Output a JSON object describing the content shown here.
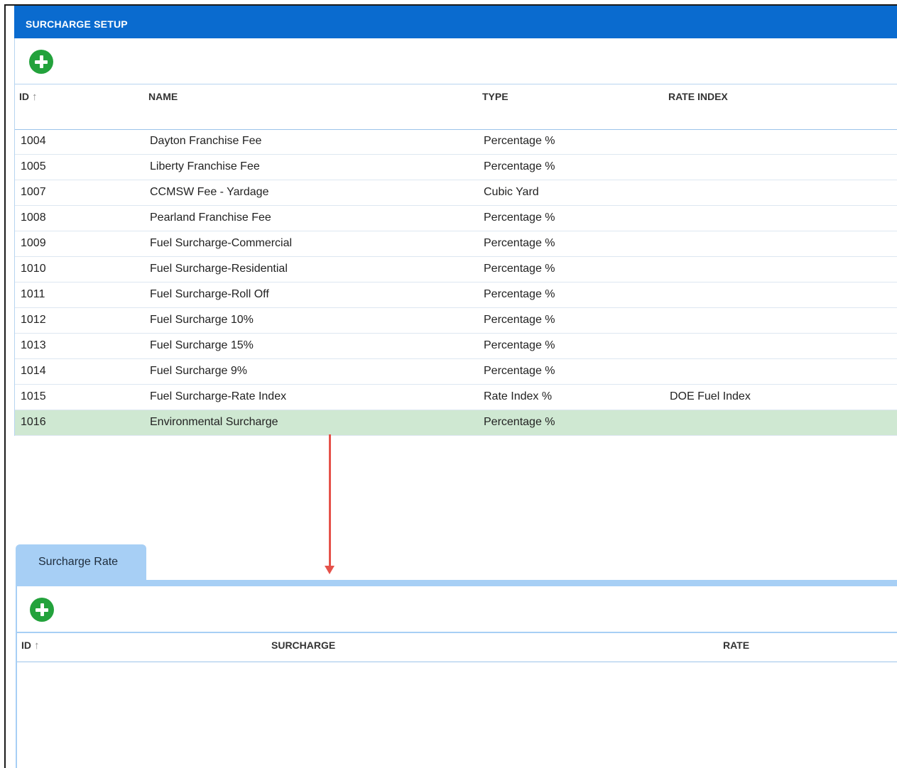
{
  "header": {
    "title": "SURCHARGE SETUP"
  },
  "main_grid": {
    "columns": {
      "id": "ID",
      "name": "NAME",
      "type": "TYPE",
      "rate_index": "RATE INDEX"
    },
    "rows": [
      {
        "id": "1004",
        "name": "Dayton Franchise Fee",
        "type": "Percentage %",
        "rate_index": ""
      },
      {
        "id": "1005",
        "name": "Liberty Franchise Fee",
        "type": "Percentage %",
        "rate_index": ""
      },
      {
        "id": "1007",
        "name": "CCMSW Fee - Yardage",
        "type": "Cubic Yard",
        "rate_index": ""
      },
      {
        "id": "1008",
        "name": "Pearland Franchise Fee",
        "type": "Percentage %",
        "rate_index": ""
      },
      {
        "id": "1009",
        "name": "Fuel Surcharge-Commercial",
        "type": "Percentage %",
        "rate_index": ""
      },
      {
        "id": "1010",
        "name": "Fuel Surcharge-Residential",
        "type": "Percentage %",
        "rate_index": ""
      },
      {
        "id": "1011",
        "name": "Fuel Surcharge-Roll Off",
        "type": "Percentage %",
        "rate_index": ""
      },
      {
        "id": "1012",
        "name": "Fuel Surcharge 10%",
        "type": "Percentage %",
        "rate_index": ""
      },
      {
        "id": "1013",
        "name": "Fuel Surcharge 15%",
        "type": "Percentage %",
        "rate_index": ""
      },
      {
        "id": "1014",
        "name": "Fuel Surcharge 9%",
        "type": "Percentage %",
        "rate_index": ""
      },
      {
        "id": "1015",
        "name": "Fuel Surcharge-Rate Index",
        "type": "Rate Index %",
        "rate_index": "DOE Fuel Index"
      },
      {
        "id": "1016",
        "name": "Environmental Surcharge",
        "type": "Percentage %",
        "rate_index": ""
      }
    ],
    "selected_id": "1016"
  },
  "tabs": [
    {
      "label": "Surcharge Rate"
    }
  ],
  "rate_grid": {
    "columns": {
      "id": "ID",
      "surcharge": "SURCHARGE",
      "rate": "RATE"
    }
  },
  "colors": {
    "header": "#0a6bcf",
    "selected_row": "#cfe8d2",
    "add_button": "#23a23c",
    "tab": "#a7cff5",
    "annotation_arrow": "#e5524a"
  },
  "icons": {
    "add": "plus-circle-icon",
    "sort": "arrow-up-icon"
  }
}
